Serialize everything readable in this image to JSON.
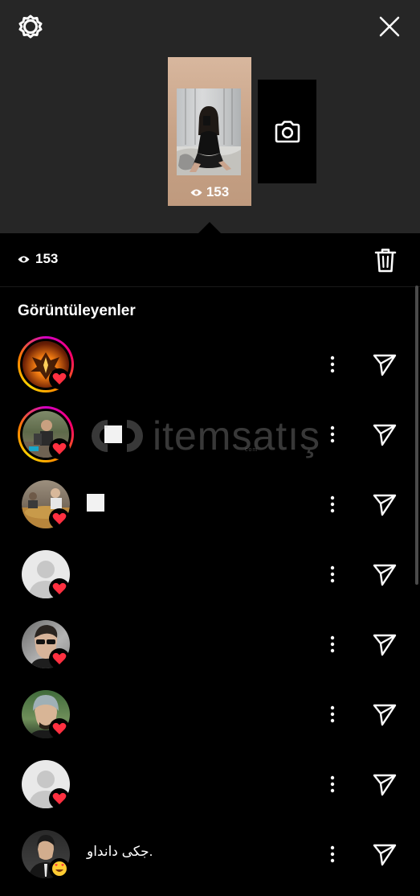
{
  "header": {
    "settings_icon": "gear-icon",
    "close_icon": "close-icon",
    "story_view_count": "153",
    "camera_icon": "camera-icon"
  },
  "stats": {
    "view_count": "153",
    "eye_icon": "eye-icon",
    "delete_icon": "trash-icon"
  },
  "section_title": "Görüntüleyenler",
  "viewers": [
    {
      "name": "",
      "ring": true,
      "avatar": "phoenix",
      "badge": "heart"
    },
    {
      "name": "",
      "ring": true,
      "avatar": "outdoor",
      "badge": "heart"
    },
    {
      "name": "",
      "ring": false,
      "avatar": "room",
      "badge": "heart"
    },
    {
      "name": "",
      "ring": false,
      "avatar": "default",
      "badge": "heart"
    },
    {
      "name": "",
      "ring": false,
      "avatar": "man-sunglasses",
      "badge": "heart"
    },
    {
      "name": "",
      "ring": false,
      "avatar": "man-beanie",
      "badge": "heart"
    },
    {
      "name": "",
      "ring": false,
      "avatar": "default",
      "badge": "heart"
    },
    {
      "name": ".جکی دانداو",
      "ring": false,
      "avatar": "man-suit",
      "badge": "heart-eyes"
    }
  ],
  "watermark": {
    "text": "itemsatış",
    "sub": "com"
  },
  "colors": {
    "top_bg": "#262626",
    "list_bg": "#000000",
    "heart": "#ff3040",
    "ring_start": "#d300c5",
    "ring_end": "#ffd600"
  }
}
